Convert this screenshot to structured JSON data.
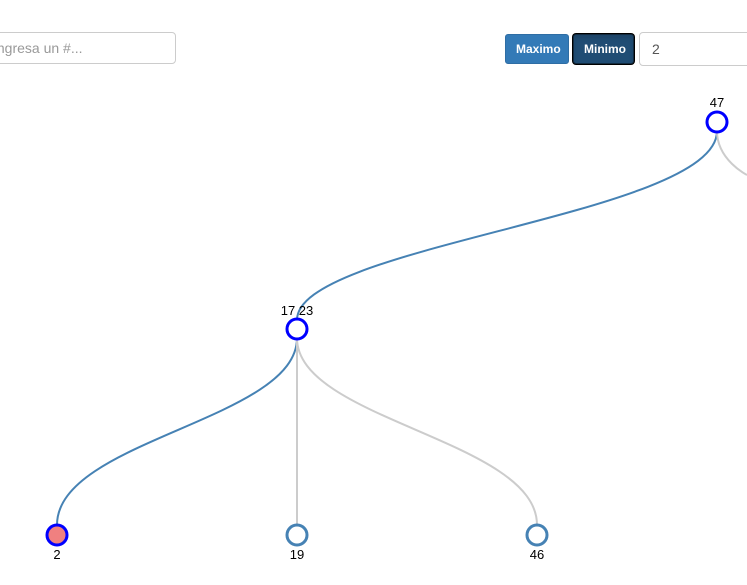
{
  "search": {
    "placeholder": "Ingresa un #..."
  },
  "toolbar": {
    "max_label": "Maximo",
    "min_label": "Minimo",
    "value": "2"
  },
  "colors": {
    "primary": "#337ab7",
    "active": "#204d74",
    "link_highlight": "#4682b4",
    "link_default": "#cccccc",
    "node_highlight_stroke": "#0000ff",
    "node_default_stroke": "#4682b4",
    "node_found_fill": "#f08080"
  },
  "tree": {
    "root": {
      "label": "47"
    },
    "middle": {
      "label": "17 23"
    },
    "leaves": [
      {
        "label": "2"
      },
      {
        "label": "19"
      },
      {
        "label": "46"
      }
    ]
  }
}
